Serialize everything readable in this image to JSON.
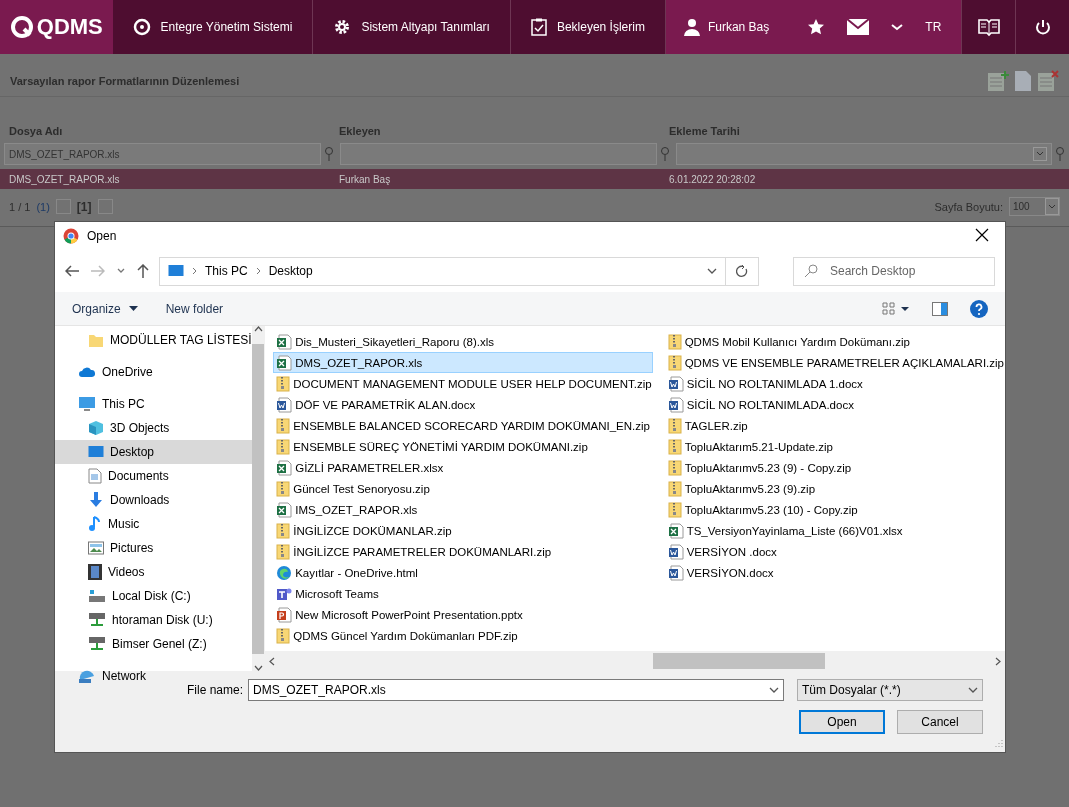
{
  "app": {
    "logo": "QDMS",
    "menu": [
      {
        "label": "Entegre Yönetim Sistemi",
        "kind": "q"
      },
      {
        "label": "Sistem Altyapı Tanımları",
        "kind": "gear"
      },
      {
        "label": "Bekleyen İşlerim",
        "kind": "clipboard"
      }
    ],
    "user": "Furkan Baş",
    "language": "TR"
  },
  "page": {
    "title": "Varsayılan rapor Formatlarının Düzenlemesi",
    "table": {
      "columns": [
        "Dosya Adı",
        "Ekleyen",
        "Ekleme Tarihi"
      ],
      "filters": [
        {
          "value": "DMS_OZET_RAPOR.xls",
          "kind": "text"
        },
        {
          "kind": "text"
        },
        {
          "kind": "dropdown"
        }
      ],
      "rows": [
        {
          "cells": [
            "DMS_OZET_RAPOR.xls",
            "Furkan Baş",
            "6.01.2022 20:28:02"
          ],
          "selected": true
        }
      ]
    },
    "pager": {
      "summary": "1 / 1",
      "count": "(1)",
      "current": "[1]",
      "page_size_label": "Sayfa Boyutu:",
      "page_size": "100"
    }
  },
  "dialog": {
    "title": "Open",
    "breadcrumb": [
      "This PC",
      "Desktop"
    ],
    "search": {
      "placeholder": "Search Desktop"
    },
    "toolbar": [
      "Organize",
      "New folder"
    ],
    "nav": [
      {
        "label": "MODÜLLER TAG LİSTESİ",
        "kind": "folder",
        "selected": false
      },
      {
        "label": "OneDrive",
        "kind": "cloud",
        "selected": false
      },
      {
        "label": "This PC",
        "kind": "pc",
        "selected": false
      },
      {
        "label": "3D Objects",
        "kind": "cube",
        "selected": false
      },
      {
        "label": "Desktop",
        "kind": "desktop",
        "selected": true
      },
      {
        "label": "Documents",
        "kind": "doc",
        "selected": false
      },
      {
        "label": "Downloads",
        "kind": "download",
        "selected": false
      },
      {
        "label": "Music",
        "kind": "music",
        "selected": false
      },
      {
        "label": "Pictures",
        "kind": "pictures",
        "selected": false
      },
      {
        "label": "Videos",
        "kind": "film",
        "selected": false
      },
      {
        "label": "Local Disk (C:)",
        "kind": "disk",
        "selected": false
      },
      {
        "label": "htoraman Disk (U:)",
        "kind": "netdisk",
        "selected": false
      },
      {
        "label": "Bimser Genel (Z:)",
        "kind": "netdisk",
        "selected": false
      },
      {
        "label": "Network",
        "kind": "network",
        "selected": false
      }
    ],
    "files": [
      {
        "name": "Dis_Musteri_Sikayetleri_Raporu (8).xls",
        "kind": "xls",
        "selected": false
      },
      {
        "name": "DMS_OZET_RAPOR.xls",
        "kind": "xls",
        "selected": true
      },
      {
        "name": "DOCUMENT MANAGEMENT MODULE USER HELP DOCUMENT.zip",
        "kind": "zip",
        "selected": false
      },
      {
        "name": "DÖF VE PARAMETRİK ALAN.docx",
        "kind": "docx",
        "selected": false
      },
      {
        "name": "ENSEMBLE BALANCED SCORECARD YARDIM DOKÜMANI_EN.zip",
        "kind": "zip",
        "selected": false
      },
      {
        "name": "ENSEMBLE SÜREÇ YÖNETİMİ YARDIM DOKÜMANI.zip",
        "kind": "zip",
        "selected": false
      },
      {
        "name": "GİZLİ PARAMETRELER.xlsx",
        "kind": "xlsx",
        "selected": false
      },
      {
        "name": "Güncel Test Senoryosu.zip",
        "kind": "zip",
        "selected": false
      },
      {
        "name": "IMS_OZET_RAPOR.xls",
        "kind": "xls",
        "selected": false
      },
      {
        "name": "İNGİLİZCE DOKÜMANLAR.zip",
        "kind": "zip",
        "selected": false
      },
      {
        "name": "İNGİLİZCE PARAMETRELER DOKÜMANLARI.zip",
        "kind": "zip",
        "selected": false
      },
      {
        "name": "Kayıtlar - OneDrive.html",
        "kind": "html",
        "selected": false
      },
      {
        "name": "Microsoft Teams",
        "kind": "app",
        "selected": false
      },
      {
        "name": "New Microsoft PowerPoint Presentation.pptx",
        "kind": "pptx",
        "selected": false
      },
      {
        "name": "QDMS Güncel Yardım Dokümanları PDF.zip",
        "kind": "zip",
        "selected": false
      },
      {
        "name": "QDMS Mobil Kullanıcı Yardım Dokümanı.zip",
        "kind": "zip",
        "selected": false
      },
      {
        "name": "QDMS VE ENSEMBLE PARAMETRELER AÇIKLAMALARI.zip",
        "kind": "zip",
        "selected": false
      },
      {
        "name": "SİCİL NO ROLTANIMLADA 1.docx",
        "kind": "docx",
        "selected": false
      },
      {
        "name": "SİCİL NO ROLTANIMLADA.docx",
        "kind": "docx",
        "selected": false
      },
      {
        "name": "TAGLER.zip",
        "kind": "zip",
        "selected": false
      },
      {
        "name": "TopluAktarım5.21-Update.zip",
        "kind": "zip",
        "selected": false
      },
      {
        "name": "TopluAktarımv5.23 (9) - Copy.zip",
        "kind": "zip",
        "selected": false
      },
      {
        "name": "TopluAktarımv5.23 (9).zip",
        "kind": "zip",
        "selected": false
      },
      {
        "name": "TopluAktarımv5.23 (10) - Copy.zip",
        "kind": "zip",
        "selected": false
      },
      {
        "name": "TS_VersiyonYayinlama_Liste (66)V01.xlsx",
        "kind": "xlsx",
        "selected": false
      },
      {
        "name": "VERSİYON .docx",
        "kind": "docx",
        "selected": false
      },
      {
        "name": "VERSİYON.docx",
        "kind": "docx",
        "selected": false
      }
    ],
    "file_name_label": "File name:",
    "file_name": "DMS_OZET_RAPOR.xls",
    "file_type": "Tüm Dosyalar (*.*)",
    "buttons": [
      {
        "label": "Open",
        "kind": "primary"
      },
      {
        "label": "Cancel",
        "kind": "normal"
      }
    ]
  }
}
